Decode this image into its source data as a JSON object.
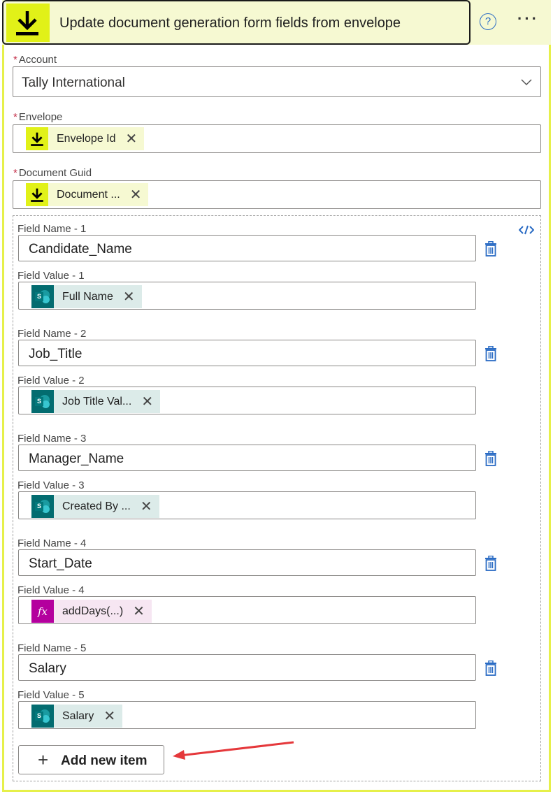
{
  "header": {
    "title": "Update document generation form fields from envelope",
    "help_icon": "?",
    "more_icon": "···"
  },
  "account": {
    "label": "Account",
    "required": "*",
    "value": "Tally International"
  },
  "envelope": {
    "label": "Envelope",
    "required": "*",
    "token": "Envelope Id"
  },
  "document_guid": {
    "label": "Document Guid",
    "required": "*",
    "token": "Document ..."
  },
  "fields": [
    {
      "name_label": "Field Name - 1",
      "name_value": "Candidate_Name",
      "value_label": "Field Value - 1",
      "token": "Full Name",
      "token_icon": "sharepoint-icon"
    },
    {
      "name_label": "Field Name - 2",
      "name_value": "Job_Title",
      "value_label": "Field Value - 2",
      "token": "Job Title Val...",
      "token_icon": "sharepoint-icon"
    },
    {
      "name_label": "Field Name - 3",
      "name_value": "Manager_Name",
      "value_label": "Field Value - 3",
      "token": "Created By ...",
      "token_icon": "sharepoint-icon"
    },
    {
      "name_label": "Field Name - 4",
      "name_value": "Start_Date",
      "value_label": "Field Value - 4",
      "token": "addDays(...)",
      "token_icon": "fx-icon"
    },
    {
      "name_label": "Field Name - 5",
      "name_value": "Salary",
      "value_label": "Field Value - 5",
      "token": "Salary",
      "token_icon": "sharepoint-icon"
    }
  ],
  "add_button": {
    "plus": "+",
    "label": "Add new item"
  },
  "token_remove": "✕",
  "fx_symbol": "fx",
  "sp_letter": "S",
  "colors": {
    "accent_yellow": "#e1f118",
    "header_bg": "#f6f9d2",
    "link_blue": "#2b6cc4",
    "sharepoint_teal": "#036c70",
    "fx_magenta": "#b4009e",
    "required_red": "#c4314b",
    "arrow_red": "#e5383b"
  }
}
